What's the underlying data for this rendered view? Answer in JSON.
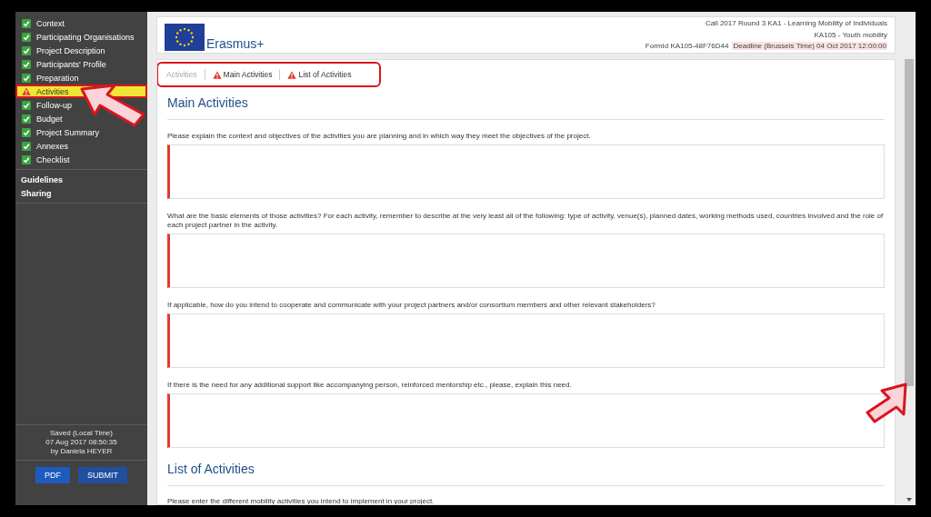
{
  "sidebar": {
    "items": [
      {
        "label": "Context",
        "warning": false,
        "selected": false
      },
      {
        "label": "Participating Organisations",
        "warning": false,
        "selected": false
      },
      {
        "label": "Project Description",
        "warning": false,
        "selected": false
      },
      {
        "label": "Participants' Profile",
        "warning": false,
        "selected": false
      },
      {
        "label": "Preparation",
        "warning": false,
        "selected": false
      },
      {
        "label": "Activities",
        "warning": true,
        "selected": true
      },
      {
        "label": "Follow-up",
        "warning": false,
        "selected": false
      },
      {
        "label": "Budget",
        "warning": false,
        "selected": false
      },
      {
        "label": "Project Summary",
        "warning": false,
        "selected": false
      },
      {
        "label": "Annexes",
        "warning": false,
        "selected": false
      },
      {
        "label": "Checklist",
        "warning": false,
        "selected": false
      }
    ],
    "links": [
      "Guidelines",
      "Sharing"
    ],
    "saved": [
      "Saved (Local Time)",
      "07 Aug 2017 08:50:35",
      "by Daniela HEYER"
    ],
    "buttons": [
      "PDF",
      "SUBMIT"
    ]
  },
  "header": {
    "logo_text": "Erasmus+",
    "call": "Call 2017  Round 3  KA1 - Learning Mobility of Individuals",
    "action": "KA105 - Youth mobility",
    "form_id": "FormId KA105-48F76D44",
    "deadline": "Deadline (Brussels Time) 04 Oct 2017 12:00:00"
  },
  "breadcrumb": [
    {
      "label": "Activities",
      "disabled": true,
      "warning": false
    },
    {
      "label": "Main Activities",
      "disabled": false,
      "warning": true
    },
    {
      "label": "List of Activities",
      "disabled": false,
      "warning": true
    }
  ],
  "sections": [
    {
      "title": "Main Activities",
      "questions": [
        {
          "label": "Please explain the context and objectives of the activities you are planning and in which way they meet the objectives of the project.",
          "invalid": true
        },
        {
          "label": "What are the basic elements of those activities? For each activity, remember to describe at the very least all of the following: type of activity, venue(s), planned dates, working methods used, countries involved and the role of each project partner in the activity.",
          "invalid": true
        },
        {
          "label": "If applicable, how do you intend to cooperate and communicate with your project partners and/or consortium members and other relevant stakeholders?",
          "invalid": true
        },
        {
          "label": "If there is the need for any additional support like accompanying person, reinforced mentorship etc., please, explain this need.",
          "invalid": true
        }
      ]
    },
    {
      "title": "List of Activities",
      "intro": "Please enter the different mobility activities you intend to implement in your project."
    }
  ]
}
